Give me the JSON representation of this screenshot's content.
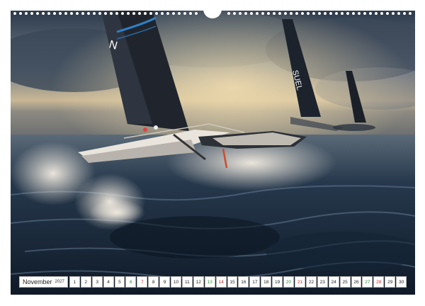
{
  "calendar": {
    "month": "November",
    "year": "2027",
    "days": [
      {
        "n": "1",
        "kind": "weekday"
      },
      {
        "n": "2",
        "kind": "weekday"
      },
      {
        "n": "3",
        "kind": "weekday"
      },
      {
        "n": "4",
        "kind": "weekday"
      },
      {
        "n": "5",
        "kind": "weekday"
      },
      {
        "n": "6",
        "kind": "sat"
      },
      {
        "n": "7",
        "kind": "sun"
      },
      {
        "n": "8",
        "kind": "weekday"
      },
      {
        "n": "9",
        "kind": "weekday"
      },
      {
        "n": "10",
        "kind": "weekday"
      },
      {
        "n": "11",
        "kind": "weekday"
      },
      {
        "n": "12",
        "kind": "weekday"
      },
      {
        "n": "13",
        "kind": "sat"
      },
      {
        "n": "14",
        "kind": "sun"
      },
      {
        "n": "15",
        "kind": "weekday"
      },
      {
        "n": "16",
        "kind": "weekday"
      },
      {
        "n": "17",
        "kind": "weekday"
      },
      {
        "n": "18",
        "kind": "weekday"
      },
      {
        "n": "19",
        "kind": "weekday"
      },
      {
        "n": "20",
        "kind": "sat"
      },
      {
        "n": "21",
        "kind": "sun"
      },
      {
        "n": "22",
        "kind": "weekday"
      },
      {
        "n": "23",
        "kind": "weekday"
      },
      {
        "n": "24",
        "kind": "weekday"
      },
      {
        "n": "25",
        "kind": "weekday"
      },
      {
        "n": "26",
        "kind": "weekday"
      },
      {
        "n": "27",
        "kind": "sat"
      },
      {
        "n": "28",
        "kind": "sun"
      },
      {
        "n": "29",
        "kind": "weekday"
      },
      {
        "n": "30",
        "kind": "weekday"
      }
    ],
    "colors": {
      "saturday": "#2e8b3a",
      "sunday": "#d0262b"
    }
  },
  "photo": {
    "sail_text_left": "N",
    "sail_text_mid": "SUEL"
  }
}
